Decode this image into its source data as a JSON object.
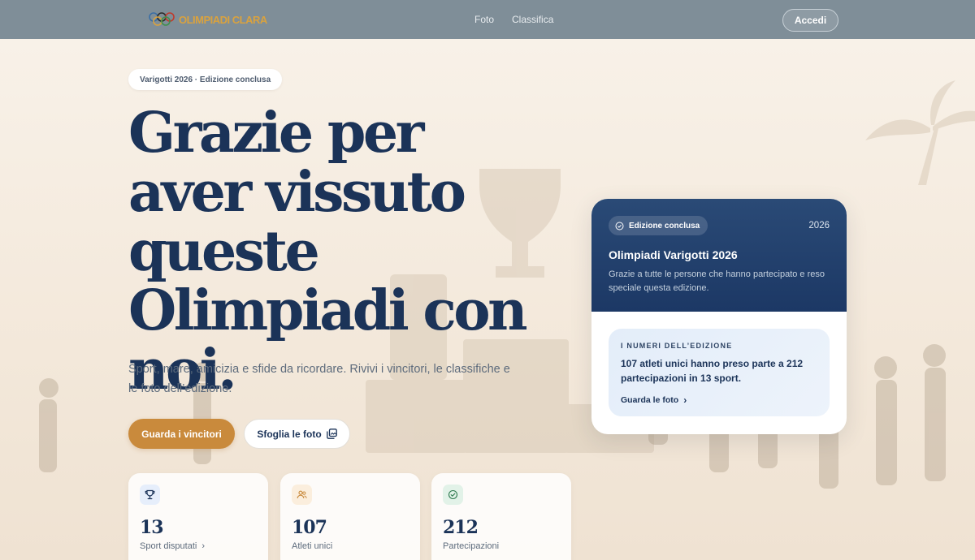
{
  "nav": {
    "logo_text": "OLIMPIADI CLARA",
    "links": [
      "Foto",
      "Classifica"
    ],
    "login_label": "Accedi"
  },
  "hero": {
    "pill": "Varigotti 2026 · Edizione conclusa",
    "title": "Grazie per aver vissuto queste Olimpiadi con noi.",
    "subtitle": "Sport, mare, amicizia e sfide da ricordare. Rivivi i vincitori, le classifiche e le foto dell’edizione.",
    "primary_button": "Guarda i vincitori",
    "secondary_button": "Sfoglia le foto"
  },
  "stats": [
    {
      "icon": "trophy-icon",
      "value": "13",
      "label": "Sport disputati"
    },
    {
      "icon": "users-icon",
      "value": "107",
      "label": "Atleti unici"
    },
    {
      "icon": "check-circle-icon",
      "value": "212",
      "label": "Partecipazioni"
    }
  ],
  "edition_card": {
    "badge": "Edizione conclusa",
    "year": "2026",
    "title": "Olimpiadi Varigotti 2026",
    "description": "Grazie a tutte le persone che hanno partecipato e reso speciale questa edizione.",
    "numbers_label": "I NUMERI DELL’EDIZIONE",
    "numbers_text": "107 atleti unici hanno preso parte a 212 partecipazioni in 13 sport.",
    "link_label": "Guarda le foto"
  },
  "colors": {
    "navy": "#1b3358",
    "accent": "#c98a3c",
    "nav_bg": "#7f8e98"
  }
}
